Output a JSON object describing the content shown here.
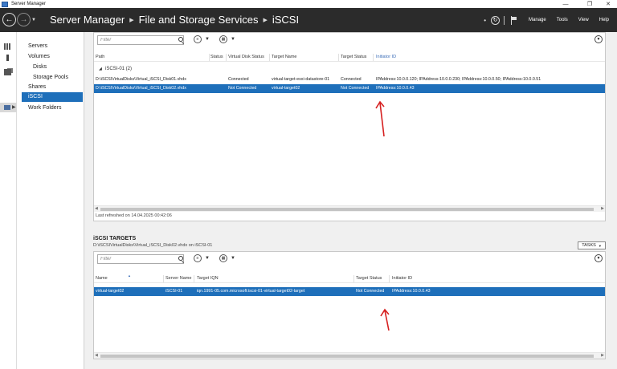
{
  "window": {
    "title": "Server Manager",
    "controls": {
      "minimize": "—",
      "restore": "❐",
      "close": "✕"
    }
  },
  "header": {
    "breadcrumb": [
      "Server Manager",
      "File and Storage Services",
      "iSCSI"
    ],
    "menu": [
      "Manage",
      "Tools",
      "View",
      "Help"
    ]
  },
  "nav": {
    "items": [
      {
        "label": "Servers",
        "level": 1
      },
      {
        "label": "Volumes",
        "level": 1
      },
      {
        "label": "Disks",
        "level": 2
      },
      {
        "label": "Storage Pools",
        "level": 2
      },
      {
        "label": "Shares",
        "level": 1
      },
      {
        "label": "iSCSI",
        "level": 1,
        "active": true
      },
      {
        "label": "Work Folders",
        "level": 1
      }
    ]
  },
  "disks": {
    "filter_placeholder": "Filter",
    "columns": [
      "Path",
      "Status",
      "Virtual Disk Status",
      "Target Name",
      "Target Status",
      "Initiator ID"
    ],
    "group": "iSCSI-01 (2)",
    "rows": [
      {
        "path": "D:\\iSCSIVirtualDisks\\Virtual_iSCSI_Disk01.vhdx",
        "status": "",
        "vd_status": "Connected",
        "target": "virtual-target-esxi-datastore-01",
        "target_status": "Connected",
        "initiator": "IPAddress:10.0.0.120; IPAddress:10.0.0.230; IPAddress:10.0.0.50; IPAddress:10.0.0.51",
        "selected": false
      },
      {
        "path": "D:\\iSCSIVirtualDisks\\Virtual_iSCSI_Disk02.vhdx",
        "status": "",
        "vd_status": "Not Connected",
        "target": "virtual-target02",
        "target_status": "Not Connected",
        "initiator": "IPAddress:10.0.0.43",
        "selected": true
      }
    ],
    "last_refreshed": "Last refreshed on 14.04.2025 00:42:06"
  },
  "targets": {
    "title": "iSCSI TARGETS",
    "subtitle": "D:\\iSCSIVirtualDisks\\Virtual_iSCSI_Disk02.vhdx on iSCSI-01",
    "tasks_label": "TASKS",
    "filter_placeholder": "Filter",
    "columns": [
      "Name",
      "Server Name",
      "Target IQN",
      "Target Status",
      "Initiator ID"
    ],
    "rows": [
      {
        "name": "virtual-target02",
        "server": "iSCSI-01",
        "iqn": "iqn.1991-05.com.microsoft:iscsi-01-virtual-target02-target",
        "status": "Not Connected",
        "initiator": "IPAddress:10.0.0.43",
        "selected": true
      }
    ]
  },
  "colors": {
    "header_bg": "#2b2b2b",
    "selection": "#1e6fba",
    "annotation_arrow": "#d62020"
  }
}
